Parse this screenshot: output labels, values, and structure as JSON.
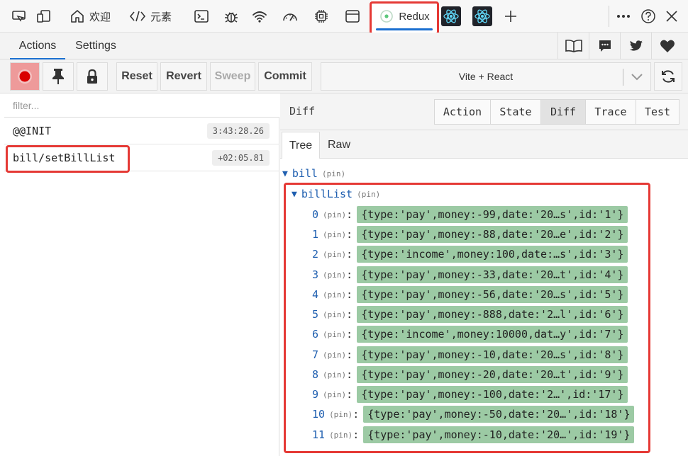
{
  "topbar": {
    "tabs": [
      {
        "icon": "device-emulation-icon"
      },
      {
        "icon": "device-icon"
      },
      {
        "icon": "home-icon",
        "label": "欢迎"
      },
      {
        "icon": "code-brackets-icon",
        "label": "元素"
      },
      {
        "icon": "console-icon"
      },
      {
        "icon": "bug-icon"
      },
      {
        "icon": "wifi-icon"
      },
      {
        "icon": "gauge-icon"
      },
      {
        "icon": "chip-icon"
      },
      {
        "icon": "window-icon"
      },
      {
        "icon": "redux-icon",
        "label": "Redux"
      },
      {
        "icon": "react-icon"
      },
      {
        "icon": "react-icon"
      },
      {
        "icon": "plus-icon"
      }
    ],
    "right_icons": [
      "more-icon",
      "help-icon",
      "close-icon"
    ],
    "accent": "#1a6fd0",
    "highlight": "#e53935"
  },
  "panel_tabs": {
    "actions_label": "Actions",
    "settings_label": "Settings",
    "icons": [
      "book-icon",
      "chat-icon",
      "twitter-icon",
      "heart-icon"
    ]
  },
  "toolbar": {
    "record_icon": "record-icon",
    "pin_icon": "pin-icon",
    "lock_icon": "lock-icon",
    "reset_label": "Reset",
    "revert_label": "Revert",
    "sweep_label": "Sweep",
    "commit_label": "Commit",
    "instance_value": "Vite + React",
    "refresh_icon": "refresh-icon"
  },
  "actions": {
    "filter_placeholder": "filter...",
    "items": [
      {
        "name": "@@INIT",
        "time": "3:43:28.26"
      },
      {
        "name": "bill/setBillList",
        "time": "+02:05.81"
      }
    ]
  },
  "inspector": {
    "title": "Diff",
    "modes": [
      "Action",
      "State",
      "Diff",
      "Trace",
      "Test"
    ],
    "active_mode": "Diff",
    "subtabs": [
      "Tree",
      "Raw"
    ],
    "active_subtab": "Tree",
    "tree": {
      "root_key": "bill",
      "root_pin": "(pin)",
      "child_key": "billList",
      "child_pin": "(pin)",
      "items": [
        {
          "index": "0",
          "pin": "(pin)",
          "value": "{type:'pay',money:-99,date:'20…s',id:'1'}"
        },
        {
          "index": "1",
          "pin": "(pin)",
          "value": "{type:'pay',money:-88,date:'20…e',id:'2'}"
        },
        {
          "index": "2",
          "pin": "(pin)",
          "value": "{type:'income',money:100,date:…s',id:'3'}"
        },
        {
          "index": "3",
          "pin": "(pin)",
          "value": "{type:'pay',money:-33,date:'20…t',id:'4'}"
        },
        {
          "index": "4",
          "pin": "(pin)",
          "value": "{type:'pay',money:-56,date:'20…s',id:'5'}"
        },
        {
          "index": "5",
          "pin": "(pin)",
          "value": "{type:'pay',money:-888,date:'2…l',id:'6'}"
        },
        {
          "index": "6",
          "pin": "(pin)",
          "value": "{type:'income',money:10000,dat…y',id:'7'}"
        },
        {
          "index": "7",
          "pin": "(pin)",
          "value": "{type:'pay',money:-10,date:'20…s',id:'8'}"
        },
        {
          "index": "8",
          "pin": "(pin)",
          "value": "{type:'pay',money:-20,date:'20…t',id:'9'}"
        },
        {
          "index": "9",
          "pin": "(pin)",
          "value": "{type:'pay',money:-100,date:'2…',id:'17'}"
        },
        {
          "index": "10",
          "pin": "(pin)",
          "value": "{type:'pay',money:-50,date:'20…',id:'18'}"
        },
        {
          "index": "11",
          "pin": "(pin)",
          "value": "{type:'pay',money:-10,date:'20…',id:'19'}"
        }
      ]
    }
  }
}
